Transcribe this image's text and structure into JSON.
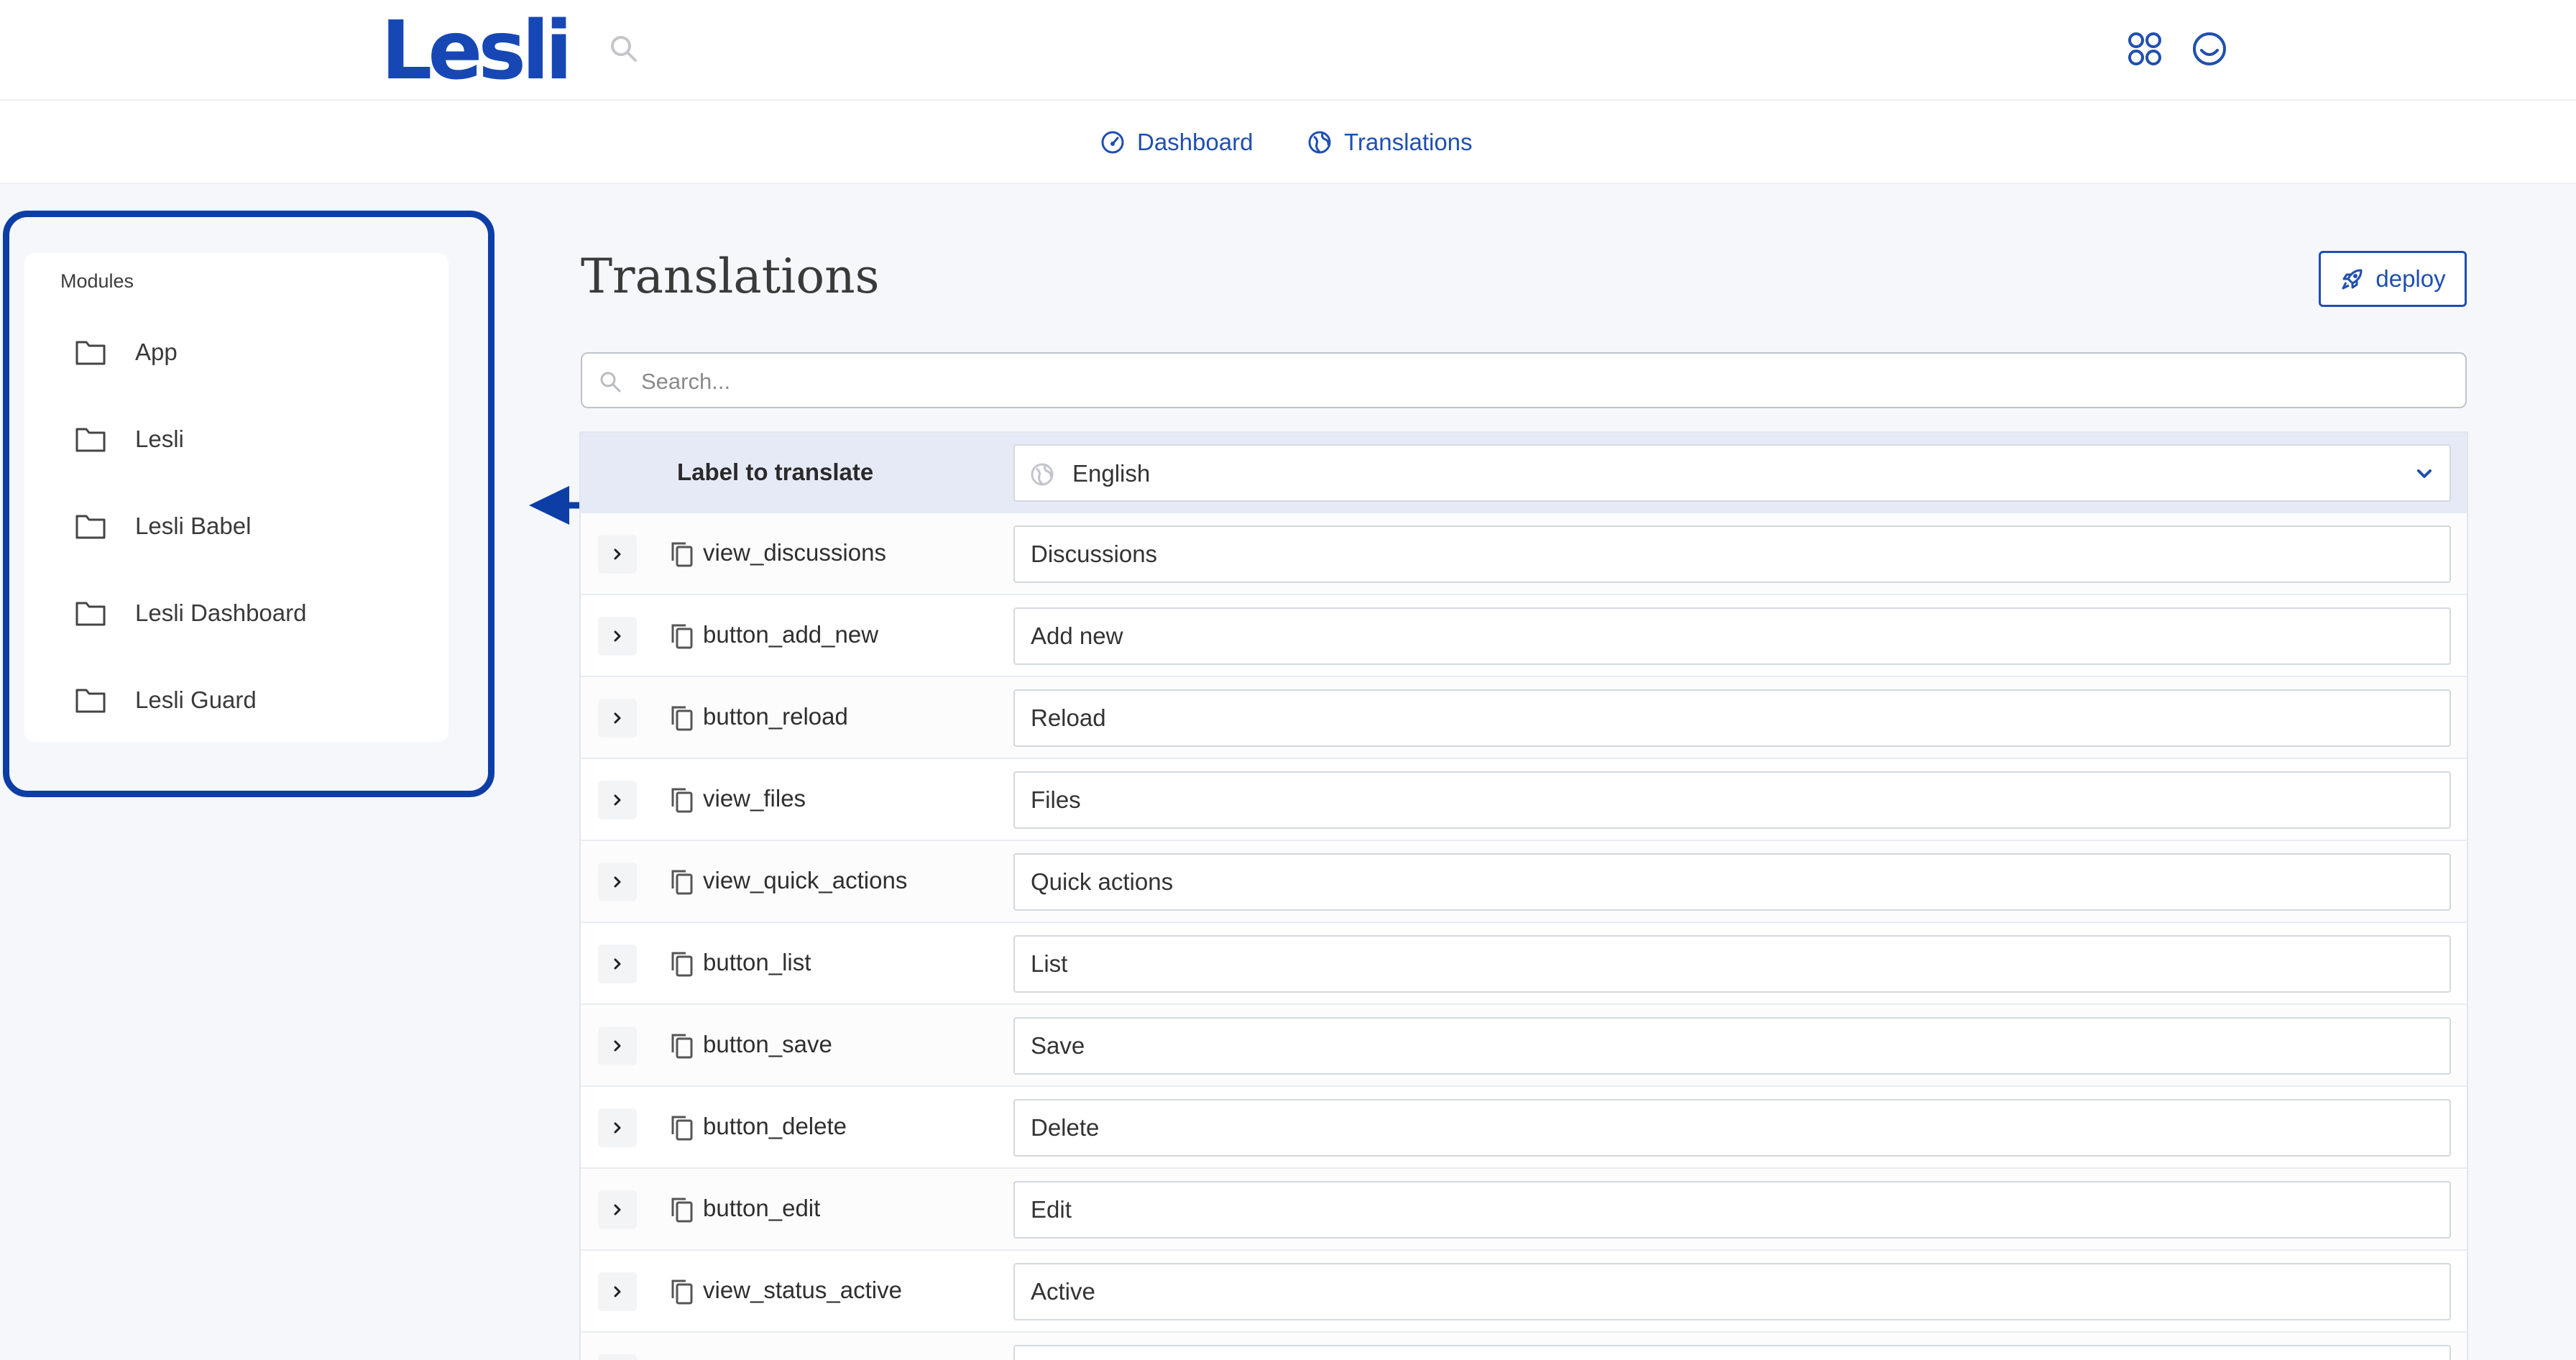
{
  "header": {
    "logo_text": "Lesli",
    "search_icon": "search-icon",
    "apps_icon": "apps-grid-icon",
    "profile_icon": "smiley-face-icon"
  },
  "subnav": {
    "dashboard_label": "Dashboard",
    "translations_label": "Translations"
  },
  "sidebar": {
    "heading": "Modules",
    "items": [
      {
        "label": "App"
      },
      {
        "label": "Lesli"
      },
      {
        "label": "Lesli Babel"
      },
      {
        "label": "Lesli Dashboard"
      },
      {
        "label": "Lesli Guard"
      }
    ]
  },
  "main": {
    "title": "Translations",
    "deploy_label": "deploy",
    "search_placeholder": "Search...",
    "table": {
      "label_header": "Label to translate",
      "language": "English",
      "rows": [
        {
          "key": "view_discussions",
          "value": "Discussions"
        },
        {
          "key": "button_add_new",
          "value": "Add new"
        },
        {
          "key": "button_reload",
          "value": "Reload"
        },
        {
          "key": "view_files",
          "value": "Files"
        },
        {
          "key": "view_quick_actions",
          "value": "Quick actions"
        },
        {
          "key": "button_list",
          "value": "List"
        },
        {
          "key": "button_save",
          "value": "Save"
        },
        {
          "key": "button_delete",
          "value": "Delete"
        },
        {
          "key": "button_edit",
          "value": "Edit"
        },
        {
          "key": "view_status_active",
          "value": "Active"
        }
      ]
    }
  },
  "colors": {
    "brand": "#1747b5",
    "accent": "#1f4fb0",
    "annotation": "#0d3ea6",
    "table_header_bg": "#e6eaf6",
    "page_bg": "#f5f7fb"
  }
}
